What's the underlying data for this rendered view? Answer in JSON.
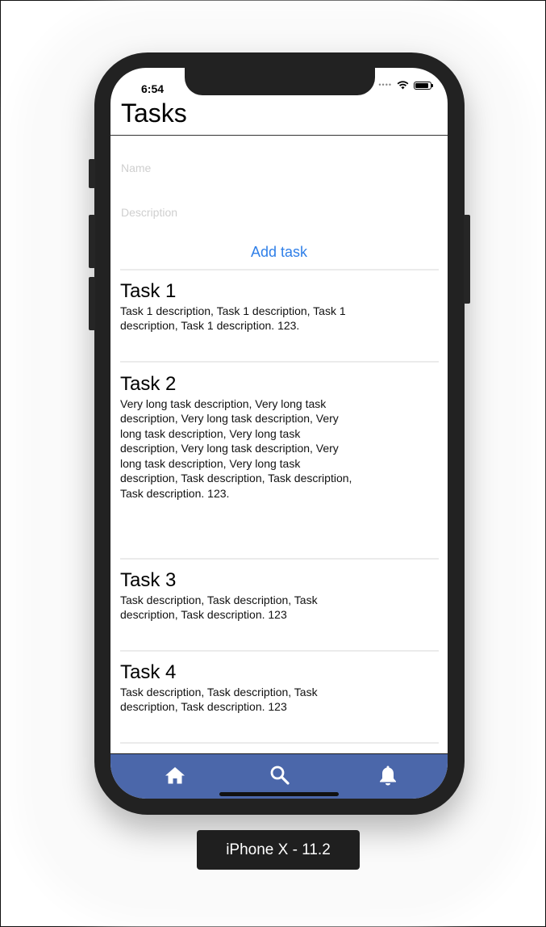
{
  "status_bar": {
    "time": "6:54"
  },
  "nav": {
    "title": "Tasks"
  },
  "form": {
    "name_placeholder": "Name",
    "description_placeholder": "Description",
    "add_label": "Add task"
  },
  "tasks": [
    {
      "title": "Task 1",
      "description": "Task 1 description, Task 1 description, Task 1 description, Task 1 description. 123."
    },
    {
      "title": "Task 2",
      "description": "Very long task description, Very long task description, Very long task description, Very long task description, Very long task description, Very long task description, Very long task description, Very long task description, Task description, Task description, Task description. 123."
    },
    {
      "title": "Task 3",
      "description": "Task description, Task description, Task description, Task description. 123"
    },
    {
      "title": "Task 4",
      "description": "Task description, Task description, Task description, Task description. 123"
    }
  ],
  "tab_bar": {
    "items": [
      {
        "icon": "home-icon"
      },
      {
        "icon": "search-icon"
      },
      {
        "icon": "bell-icon"
      }
    ],
    "background": "#4b67aa"
  },
  "colors": {
    "accent": "#2f7fe8"
  },
  "device_label": "iPhone X - 11.2"
}
